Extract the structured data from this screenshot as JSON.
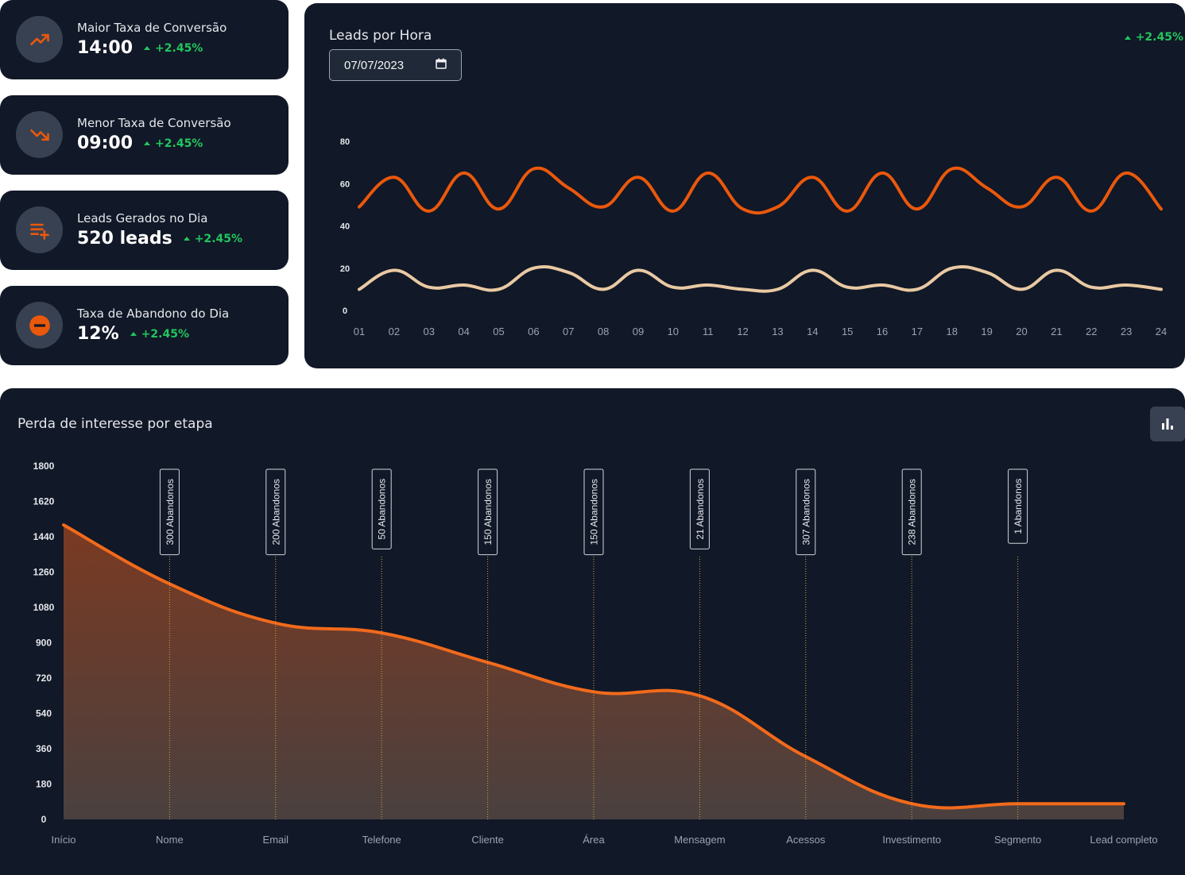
{
  "kpis": [
    {
      "title": "Maior Taxa de Conversão",
      "value": "14:00",
      "delta": "+2.45%",
      "icon": "trending-up-icon"
    },
    {
      "title": "Menor Taxa de Conversão",
      "value": "09:00",
      "delta": "+2.45%",
      "icon": "trending-down-icon"
    },
    {
      "title": "Leads Gerados no Dia",
      "value": "520 leads",
      "delta": "+2.45%",
      "icon": "playlist-add-icon"
    },
    {
      "title": "Taxa de Abandono do Dia",
      "value": "12%",
      "delta": "+2.45%",
      "icon": "minus-circle-icon"
    }
  ],
  "leads_card": {
    "title": "Leads por Hora",
    "delta": "+2.45%",
    "date": "07/07/2023",
    "date_icon": "calendar-icon"
  },
  "funnel_card": {
    "title": "Perda de interesse por etapa",
    "toggle_icon": "bar-chart-icon"
  },
  "colors": {
    "background": "#111827",
    "accent": "#ea580c",
    "series_light": "#e9c9a3",
    "positive": "#22c55e"
  },
  "chart_data": [
    {
      "type": "line",
      "title": "Leads por Hora",
      "categories": [
        "01",
        "02",
        "03",
        "04",
        "05",
        "06",
        "07",
        "08",
        "09",
        "10",
        "11",
        "12",
        "13",
        "14",
        "15",
        "16",
        "17",
        "18",
        "19",
        "20",
        "21",
        "22",
        "23",
        "24"
      ],
      "series": [
        {
          "values": [
            49,
            63,
            47,
            65,
            48,
            67,
            58,
            49,
            63,
            47,
            65,
            48,
            49,
            63,
            47,
            65,
            48,
            67,
            58,
            49,
            63,
            47,
            65,
            48
          ]
        },
        {
          "values": [
            10,
            19,
            11,
            12,
            10,
            20,
            18,
            10,
            19,
            11,
            12,
            10,
            10,
            19,
            11,
            12,
            10,
            20,
            18,
            10,
            19,
            11,
            12,
            10
          ]
        }
      ],
      "yticks": [
        0,
        20,
        40,
        60,
        80
      ],
      "ylim": [
        0,
        80
      ],
      "grid": false,
      "legend": false
    },
    {
      "type": "area",
      "title": "Perda de interesse por etapa",
      "categories": [
        "Início",
        "Nome",
        "Email",
        "Telefone",
        "Cliente",
        "Área",
        "Mensagem",
        "Acessos",
        "Investimento",
        "Segmento",
        "Lead completo"
      ],
      "values": [
        1500,
        1200,
        1000,
        950,
        800,
        650,
        630,
        320,
        80,
        80,
        80
      ],
      "annotations": [
        {
          "x": "Nome",
          "label": "300 Abandonos"
        },
        {
          "x": "Email",
          "label": "200 Abandonos"
        },
        {
          "x": "Telefone",
          "label": "50 Abandonos"
        },
        {
          "x": "Cliente",
          "label": "150 Abandonos"
        },
        {
          "x": "Área",
          "label": "150 Abandonos"
        },
        {
          "x": "Mensagem",
          "label": "21 Abandonos"
        },
        {
          "x": "Acessos",
          "label": "307 Abandonos"
        },
        {
          "x": "Investimento",
          "label": "238 Abandonos"
        },
        {
          "x": "Segmento",
          "label": "1 Abandonos"
        }
      ],
      "yticks": [
        0,
        180,
        360,
        540,
        720,
        900,
        1080,
        1260,
        1440,
        1620,
        1800
      ],
      "ylim": [
        0,
        1800
      ],
      "grid": false,
      "legend": false
    }
  ]
}
